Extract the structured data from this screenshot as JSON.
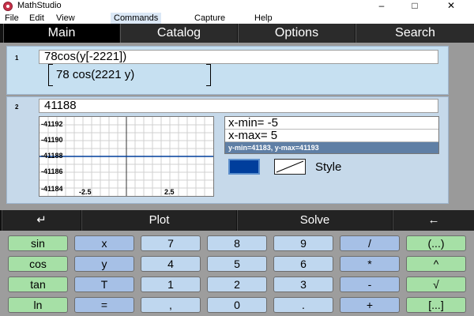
{
  "window": {
    "title": "MathStudio",
    "minimize": "–",
    "maximize": "□",
    "close": "✕"
  },
  "menu": [
    "File",
    "Edit",
    "View",
    "Commands",
    "Capture",
    "Help"
  ],
  "tabs": [
    "Main",
    "Catalog",
    "Options",
    "Search"
  ],
  "blocks": [
    {
      "number": "1",
      "input": "78cos(y[-2221])",
      "output": "78 cos(2221 y)"
    },
    {
      "number": "2",
      "input": "41188",
      "y_ticks": [
        "-41192",
        "-41190",
        "-41188",
        "-41186",
        "-41184"
      ],
      "x_ticks": [
        "-2.5",
        "2.5"
      ],
      "x_min": "x-min= -5",
      "x_max": "x-max= 5",
      "y_range": "y-min=41183, y-max=41193",
      "style_label": "Style",
      "line_color": "#003e9c"
    }
  ],
  "actions": [
    "↵",
    "Plot",
    "Solve",
    "←"
  ],
  "keys": [
    [
      "sin",
      "x",
      "7",
      "8",
      "9",
      "/",
      "(...)"
    ],
    [
      "cos",
      "y",
      "4",
      "5",
      "6",
      "*",
      "^"
    ],
    [
      "tan",
      "T",
      "1",
      "2",
      "3",
      "-",
      "√"
    ],
    [
      "ln",
      "=",
      ",",
      "0",
      ".",
      "+",
      "[...]"
    ]
  ]
}
